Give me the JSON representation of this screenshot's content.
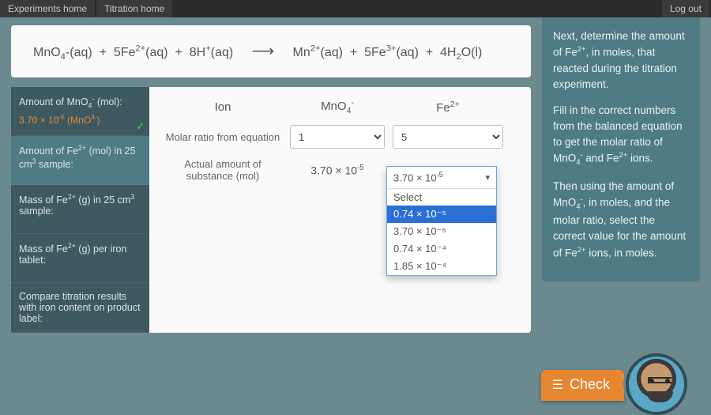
{
  "topbar": {
    "experiments": "Experiments home",
    "titration": "Titration home",
    "logout": "Log out"
  },
  "equation": {
    "t1": "MnO",
    "t1_sub": "4",
    "t1_state": "-(aq)",
    "plus": "+",
    "t2_coef": "5",
    "t2": "Fe",
    "t2_sup": "2+",
    "t2_state": "(aq)",
    "t3_coef": "8",
    "t3": "H",
    "t3_sup": "+",
    "t3_state": "(aq)",
    "arrow": "⟶",
    "p1": "Mn",
    "p1_sup": "2+",
    "p1_state": "(aq)",
    "p2_coef": "5",
    "p2": "Fe",
    "p2_sup": "3+",
    "p2_state": "(aq)",
    "p3_coef": "4",
    "p3": "H",
    "p3_sub": "2",
    "p3_tail": "O(l)"
  },
  "steps": [
    {
      "label_html": "Amount of MnO<sub>4</sub><sup>-</sup> (mol):",
      "value_html": "3.70 × 10<sup>-5</sup> (MnO<sup>4-</sup>)",
      "status": "done"
    },
    {
      "label_html": "Amount of Fe<sup>2+</sup> (mol) in 25 cm<sup>3</sup> sample:",
      "status": "active"
    },
    {
      "label_html": "Mass of Fe<sup>2+</sup> (g) in 25 cm<sup>3</sup> sample:"
    },
    {
      "label_html": "Mass of Fe<sup>2+</sup> (g) per iron tablet:"
    },
    {
      "label_html": "Compare titration results with iron content on product label:"
    }
  ],
  "workspace": {
    "headers": {
      "ion": "Ion",
      "mno4_html": "MnO<sub>4</sub><sup>-</sup>",
      "fe_html": "Fe<sup>2+</sup>"
    },
    "row_ratio_label": "Molar ratio from equation",
    "row_amount_label": "Actual amount of substance (mol)",
    "ratio_mno4": "1",
    "ratio_fe": "5",
    "amount_mno4_html": "3.70 × 10<sup>-5</sup>",
    "fe_amount_display_html": "3.70 × 10<sup>-5</sup>",
    "fe_amount_options": [
      "Select",
      "0.74 × 10⁻⁵",
      "3.70 × 10⁻⁵",
      "0.74 × 10⁻⁴",
      "1.85 × 10⁻⁴"
    ],
    "fe_amount_selected_index": 1
  },
  "hint": {
    "p1_html": "Next, determine the amount of Fe<sup>2+</sup>, in moles, that reacted during the titration experiment.",
    "p2_html": "Fill in the correct numbers from the balanced equation to get the molar ratio of MnO<sub>4</sub><sup>-</sup> and Fe<sup>2+</sup> ions.",
    "p3_html": "Then using the amount of MnO<sub>4</sub><sup>-</sup>, in moles, and the molar ratio, select the correct value for the amount of Fe<sup>2+</sup> ions, in moles."
  },
  "check_label": "Check",
  "chart_data": null
}
